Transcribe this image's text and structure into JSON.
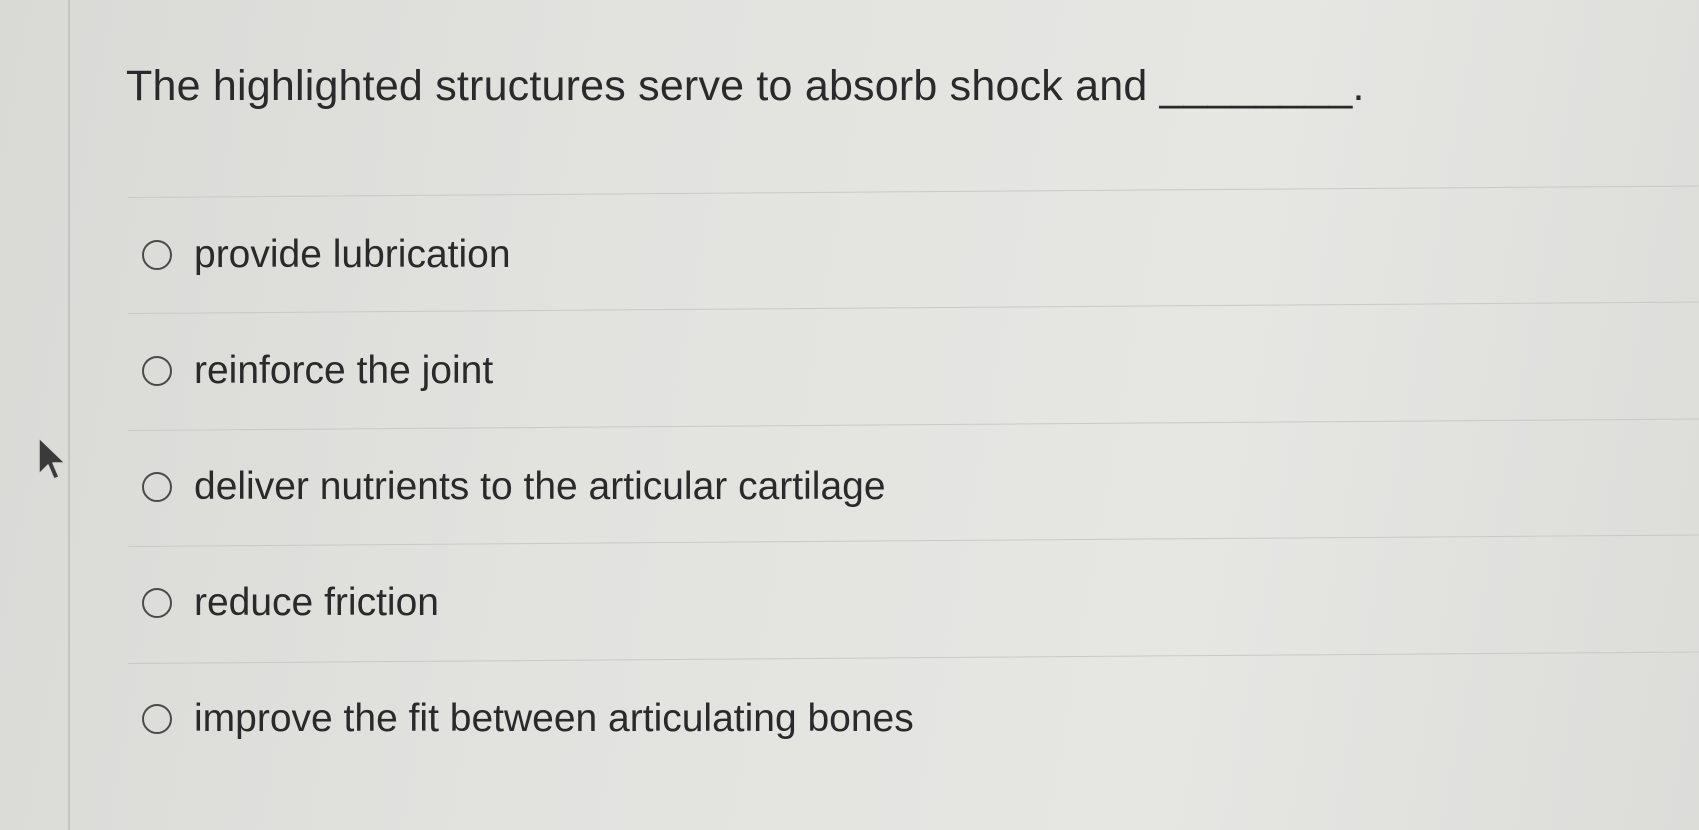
{
  "question": {
    "text": "The highlighted structures serve to absorb shock and ________."
  },
  "options": [
    {
      "label": "provide lubrication",
      "selected": false
    },
    {
      "label": "reinforce the joint",
      "selected": false
    },
    {
      "label": "deliver nutrients to the articular cartilage",
      "selected": false
    },
    {
      "label": "reduce friction",
      "selected": false
    },
    {
      "label": "improve the fit between articulating bones",
      "selected": false
    }
  ],
  "icons": {
    "cursor": "mouse-pointer-arrow",
    "radio": "empty-radio-circle"
  },
  "colors": {
    "background": "#e2e2df",
    "text": "#2a2a2a",
    "divider": "#c9c9c5"
  }
}
